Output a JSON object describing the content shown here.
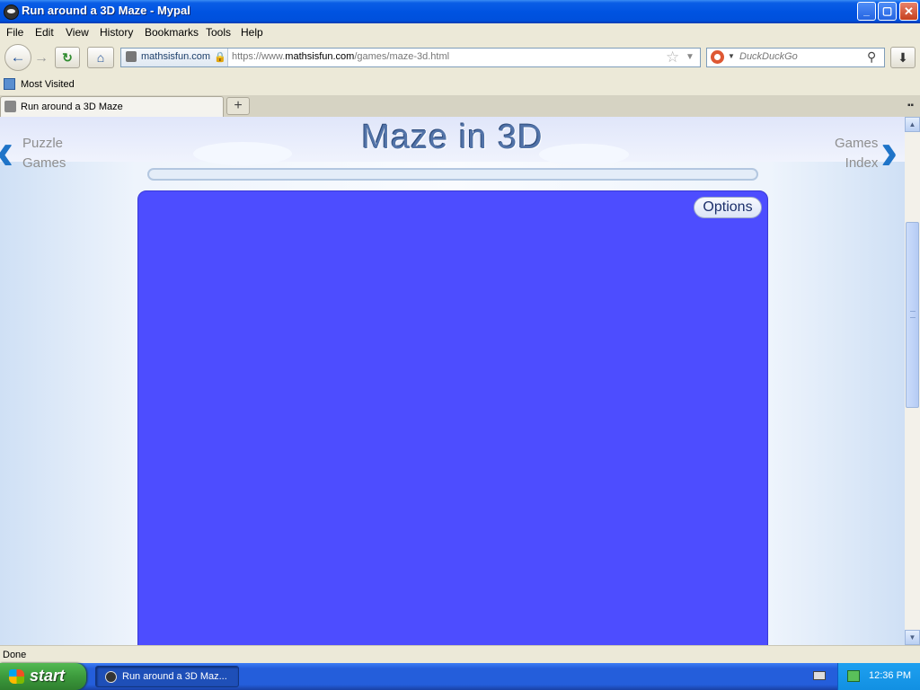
{
  "window": {
    "title": "Run around a 3D Maze - Mypal",
    "minimize": "_",
    "maximize": "▢",
    "close": "✕"
  },
  "menu": [
    "File",
    "Edit",
    "View",
    "History",
    "Bookmarks",
    "Tools",
    "Help"
  ],
  "nav": {
    "site_domain": "mathsisfun.com",
    "url_prefix": "https://www.",
    "url_host": "mathsisfun.com",
    "url_path": "/games/maze-3d.html",
    "search_placeholder": "DuckDuckGo"
  },
  "bookmarks": {
    "most_visited": "Most Visited"
  },
  "tab": {
    "title": "Run around a 3D Maze",
    "new_tab": "+"
  },
  "page": {
    "title": "Maze in 3D",
    "prev_link": [
      "Puzzle",
      "Games"
    ],
    "next_link": [
      "Games",
      "Index"
    ],
    "options_label": "Options",
    "canvas_color": "#4d4dff"
  },
  "status": {
    "text": "Done"
  },
  "taskbar": {
    "start_label": "start",
    "task_label": "Run around a 3D Maz...",
    "clock": "12:36 PM"
  },
  "icons": {
    "back": "back-arrow-icon",
    "forward": "forward-arrow-icon",
    "reload": "reload-icon",
    "home": "home-icon",
    "bookmark": "star-icon",
    "download": "download-icon"
  }
}
